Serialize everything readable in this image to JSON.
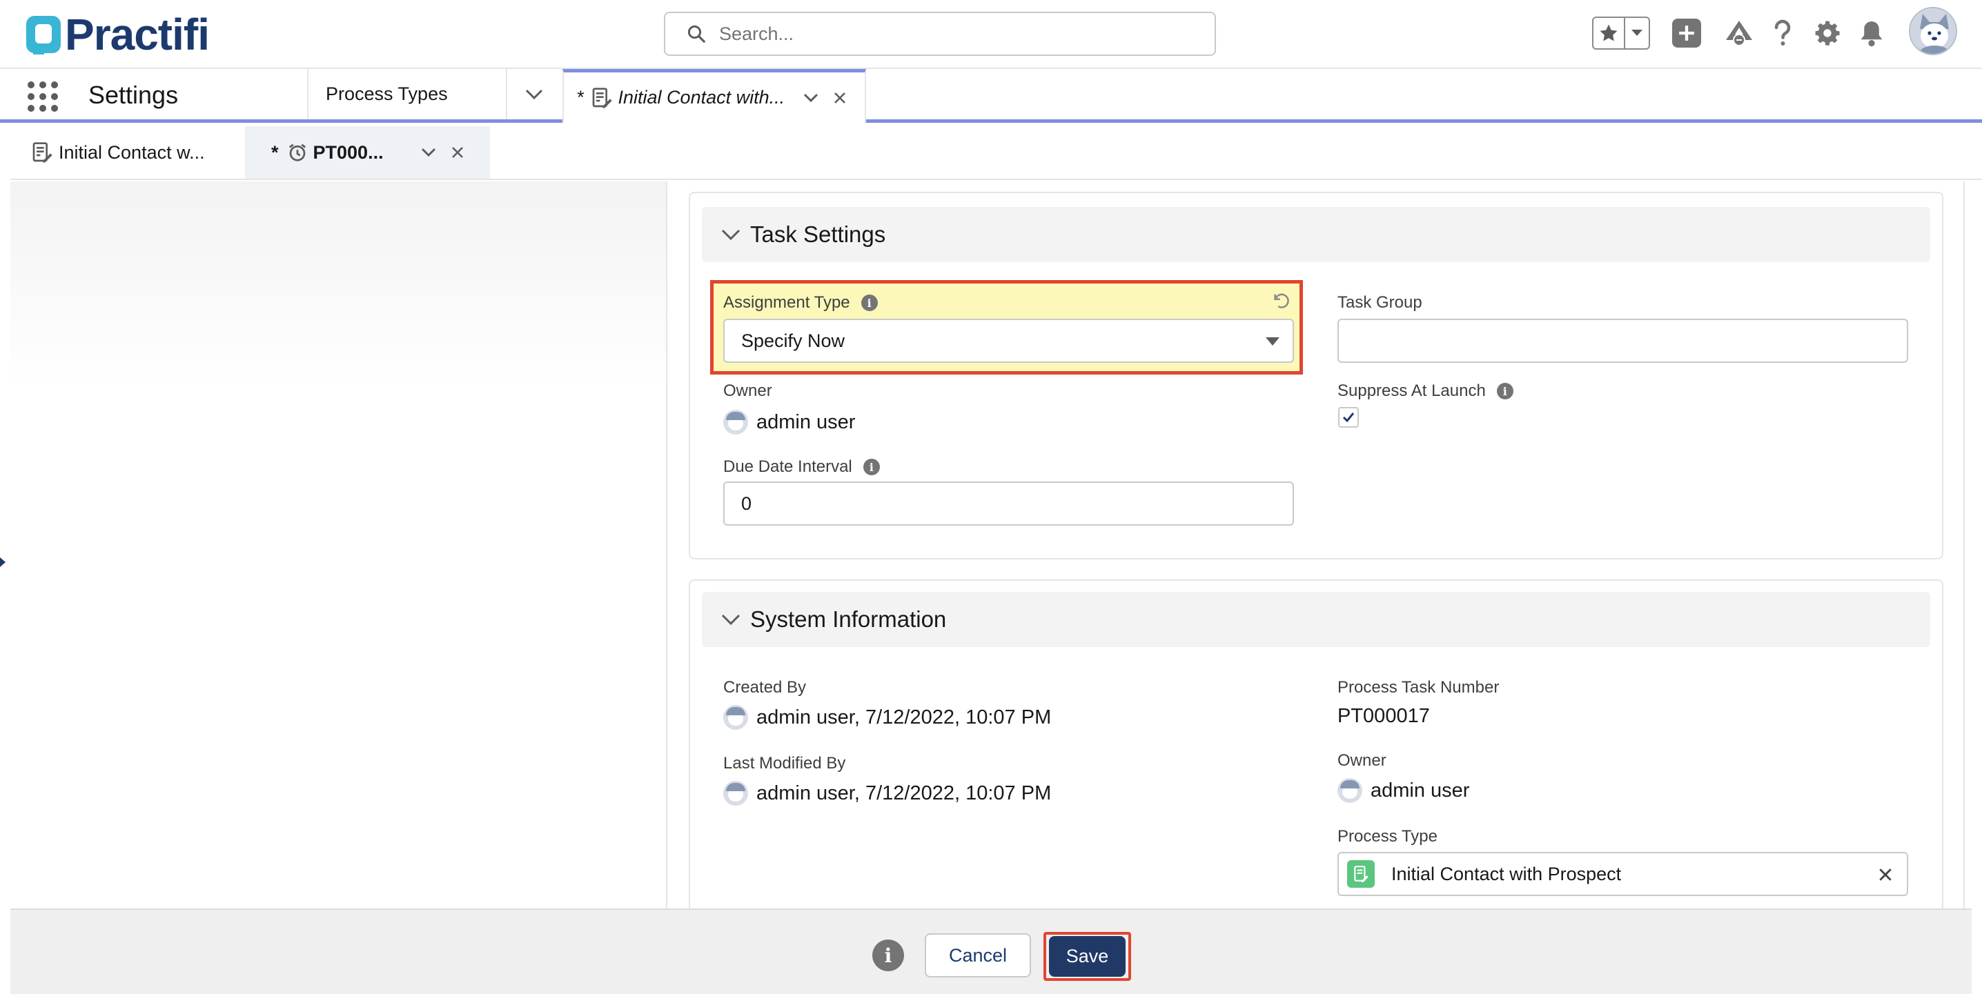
{
  "header": {
    "brand": "Practifi",
    "search_placeholder": "Search...",
    "icons": [
      "star-icon",
      "chevron-down-icon",
      "plus-icon",
      "trailhead-icon",
      "help-icon",
      "gear-icon",
      "bell-icon",
      "avatar"
    ]
  },
  "navbar": {
    "app_name": "Settings",
    "object_tab": "Process Types",
    "active_tab": {
      "dirty_marker": "*",
      "label": "Initial Contact with..."
    }
  },
  "subtabs": [
    {
      "label": "Initial Contact w..."
    },
    {
      "dirty_marker": "*",
      "label": "PT000..."
    }
  ],
  "task_settings": {
    "title": "Task Settings",
    "assignment_type": {
      "label": "Assignment Type",
      "value": "Specify Now"
    },
    "task_group": {
      "label": "Task Group",
      "value": ""
    },
    "owner": {
      "label": "Owner",
      "value": "admin user"
    },
    "suppress_at_launch": {
      "label": "Suppress At Launch",
      "checked": true
    },
    "due_date_interval": {
      "label": "Due Date Interval",
      "value": "0"
    }
  },
  "system_information": {
    "title": "System Information",
    "created_by": {
      "label": "Created By",
      "value": "admin user, 7/12/2022, 10:07 PM"
    },
    "last_modified_by": {
      "label": "Last Modified By",
      "value": "admin user, 7/12/2022, 10:07 PM"
    },
    "process_task_number": {
      "label": "Process Task Number",
      "value": "PT000017"
    },
    "owner": {
      "label": "Owner",
      "value": "admin user"
    },
    "process_type": {
      "label": "Process Type",
      "value": "Initial Contact with Prospect"
    }
  },
  "footer": {
    "cancel_label": "Cancel",
    "save_label": "Save"
  },
  "colors": {
    "brand_navy": "#1d3a6e",
    "brand_teal": "#39b5d6",
    "highlight_yellow": "#fbf8b9",
    "highlight_border": "#e0452f",
    "save_button": "#213967",
    "tab_accent": "#7f8de1"
  }
}
